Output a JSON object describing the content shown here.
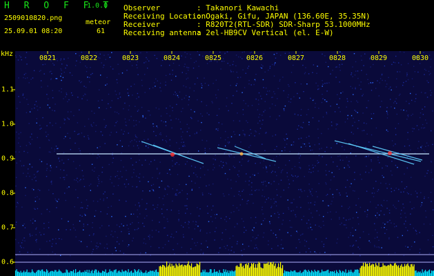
{
  "app": {
    "name": "H R O F F T",
    "version": "1.0.0"
  },
  "file": {
    "name": "2509010820.png",
    "datetime": "25.09.01 08:20",
    "meteor_label": "meteor",
    "meteor_count": "61"
  },
  "info": [
    {
      "label": "Observer",
      "value": ": Takanori Kawachi"
    },
    {
      "label": "Receiving Location",
      "value": ": Ogaki, Gifu, JAPAN (136.60E, 35.35N)"
    },
    {
      "label": "Receiver",
      "value": ": R820T2(RTL-SDR) SDR-Sharp 53.1000MHz"
    },
    {
      "label": "Receiving antenna",
      "value": ": 2el-HB9CV Vertical (el. E-W)"
    }
  ],
  "spectrogram": {
    "y_unit": "kHz",
    "x_ticks": [
      "0821",
      "0822",
      "0823",
      "0824",
      "0825",
      "0826",
      "0827",
      "0828",
      "0829",
      "0830"
    ],
    "y_ticks": [
      "1.1",
      "1.0",
      "0.9",
      "0.8",
      "0.7",
      "0.6"
    ],
    "colors": {
      "background": "#0a0a3a",
      "carrier": "#c8e6ff",
      "level": "#ffff00",
      "noise": "#00e5ff",
      "axis": "#ffff00"
    }
  }
}
